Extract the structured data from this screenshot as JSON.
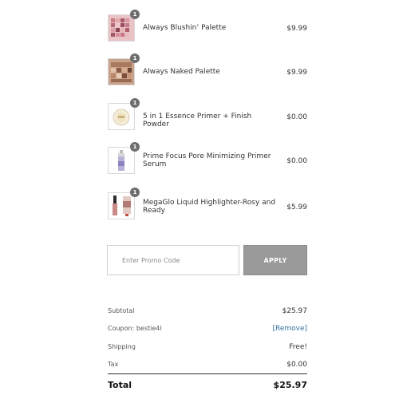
{
  "items": [
    {
      "name": "Always Blushin’ Palette",
      "price": "$9.99",
      "qty": "1",
      "thumb_icon": "pink-eyeshadow-palette-icon"
    },
    {
      "name": "Always Naked Palette",
      "price": "$9.99",
      "qty": "1",
      "thumb_icon": "nude-eyeshadow-palette-icon"
    },
    {
      "name": "5 in 1 Essence Primer + Finish Powder",
      "price": "$0.00",
      "qty": "1",
      "thumb_icon": "powder-compact-icon"
    },
    {
      "name": "Prime Focus Pore Minimizing Primer Serum",
      "price": "$0.00",
      "qty": "1",
      "thumb_icon": "primer-bottle-icon"
    },
    {
      "name": "MegaGlo Liquid Highlighter-Rosy and Ready",
      "price": "$5.99",
      "qty": "1",
      "thumb_icon": "liquid-highlighter-icon"
    }
  ],
  "promo": {
    "placeholder": "Enter Promo Code",
    "apply_label": "APPLY"
  },
  "summary": {
    "subtotal_label": "Subtotal",
    "subtotal_value": "$25.97",
    "coupon_label": "Coupon: bestie4l",
    "coupon_action": "[Remove]",
    "shipping_label": "Shipping",
    "shipping_value": "Free!",
    "tax_label": "Tax",
    "tax_value": "$0.00",
    "total_label": "Total",
    "total_value": "$25.97"
  },
  "colors": {
    "qty_badge": "#6e6e6e",
    "apply_button": "#9a9a9a",
    "remove_link": "#2f6f9f"
  }
}
